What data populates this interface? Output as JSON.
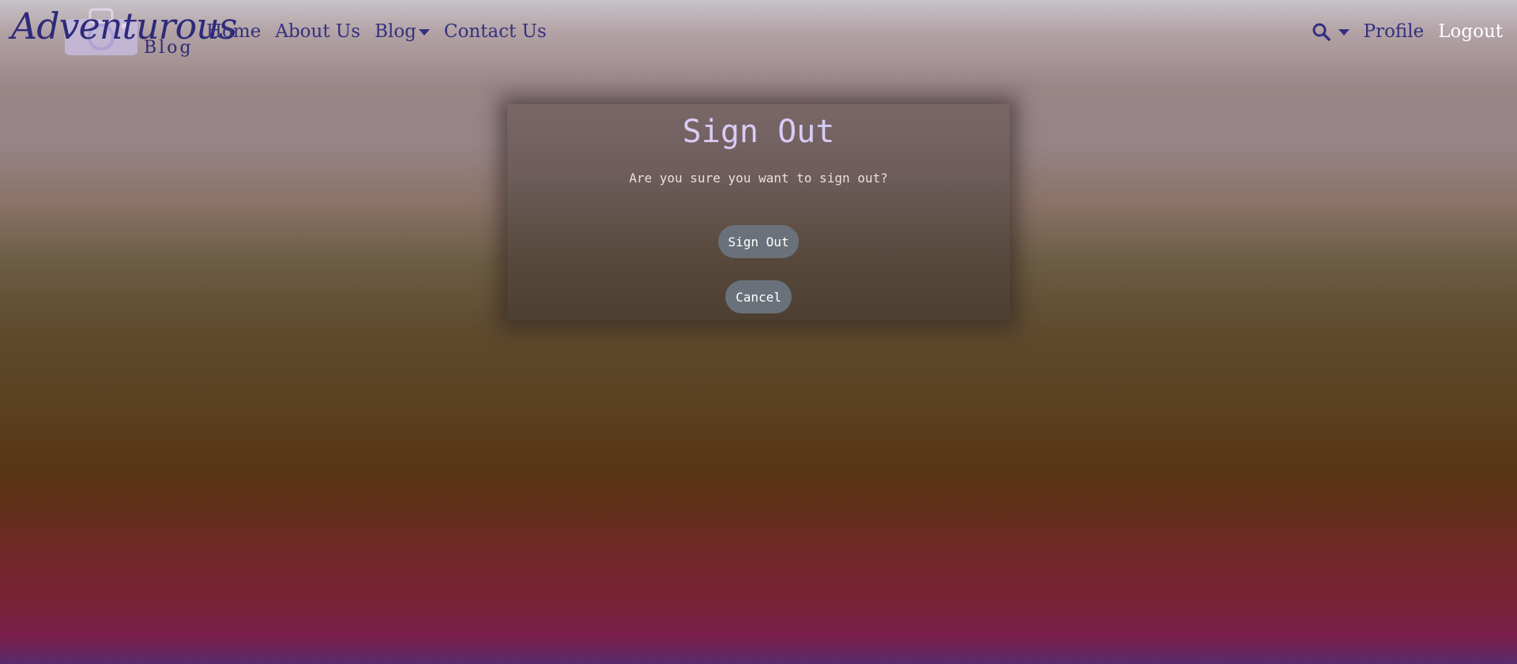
{
  "brand": {
    "script": "Adventurous",
    "sub": "Blog"
  },
  "nav": {
    "home": "Home",
    "about": "About Us",
    "blog": "Blog",
    "contact": "Contact Us",
    "profile": "Profile",
    "logout": "Logout"
  },
  "icons": {
    "search": "search-icon",
    "caret": "caret-down-icon",
    "logo": "camera-icon"
  },
  "colors": {
    "nav_text": "#34307f",
    "logout_text": "#ffffff",
    "modal_title": "#d8ccf5",
    "button_bg": "#6a717a"
  },
  "modal": {
    "title": "Sign Out",
    "message": "Are you sure you want to sign out?",
    "confirm_label": "Sign Out",
    "cancel_label": "Cancel"
  }
}
